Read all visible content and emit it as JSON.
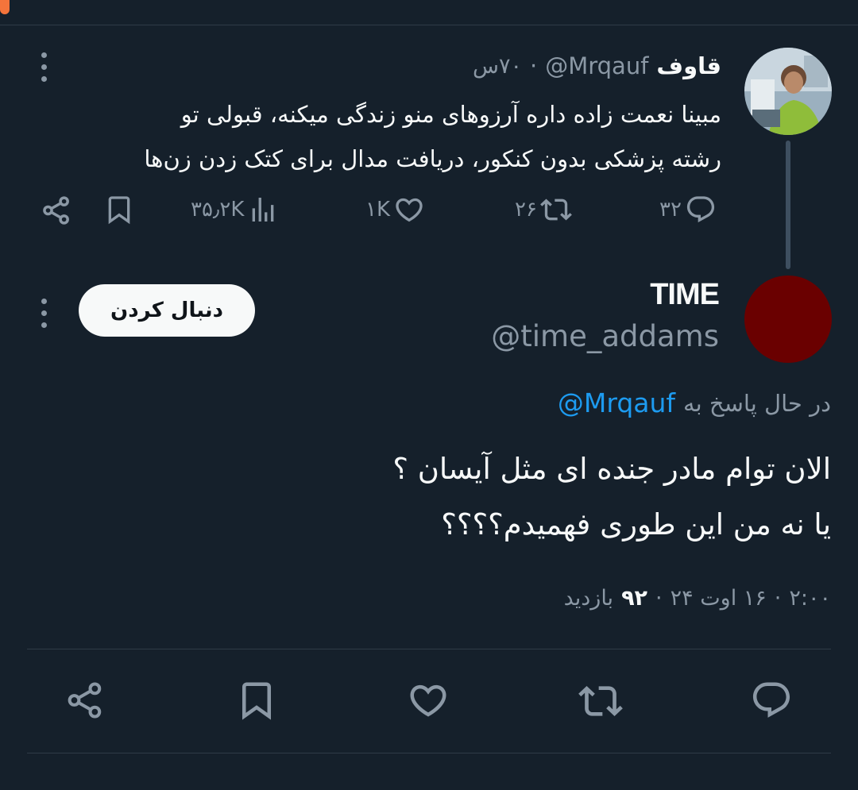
{
  "parent_tweet": {
    "display_name": "قاوف",
    "handle": "@Mrqauf",
    "time_ago": "۷۰س",
    "separator": "·",
    "text_line1": "مبینا نعمت زاده داره آرزوهای منو زندگی میکنه، قبولی تو",
    "text_line2": "رشته پزشکی بدون کنکور، دریافت مدال برای کتک زدن زن‌ها",
    "replies": "۳۲",
    "retweets": "۲۶",
    "likes": "۱K",
    "views": "۳۵٫۲K"
  },
  "reply_tweet": {
    "display_name": "TIME",
    "handle": "@time_addams",
    "follow_label": "دنبال کردن",
    "replying_to_prefix": "در حال پاسخ به",
    "replying_to_handle": "@Mrqauf",
    "text_line1": "الان توام مادر جنده ای مثل آیسان ؟",
    "text_line2": "یا نه من این طوری فهمیدم؟؟؟؟",
    "time": "۲:۰۰",
    "date": "۱۶ اوت ۲۴",
    "views_count": "۹۲",
    "views_label": "بازدید",
    "separator": "·"
  },
  "icons": {
    "reply": "comment-icon",
    "retweet": "retweet-icon",
    "like": "heart-icon",
    "views": "views-chart-icon",
    "bookmark": "bookmark-icon",
    "share": "share-icon",
    "more": "more-vertical-icon"
  },
  "colors": {
    "background": "#15202b",
    "text": "#f7f9f9",
    "secondary": "#8b98a5",
    "link": "#1d9bf0",
    "avatar2": "#6a0000"
  }
}
